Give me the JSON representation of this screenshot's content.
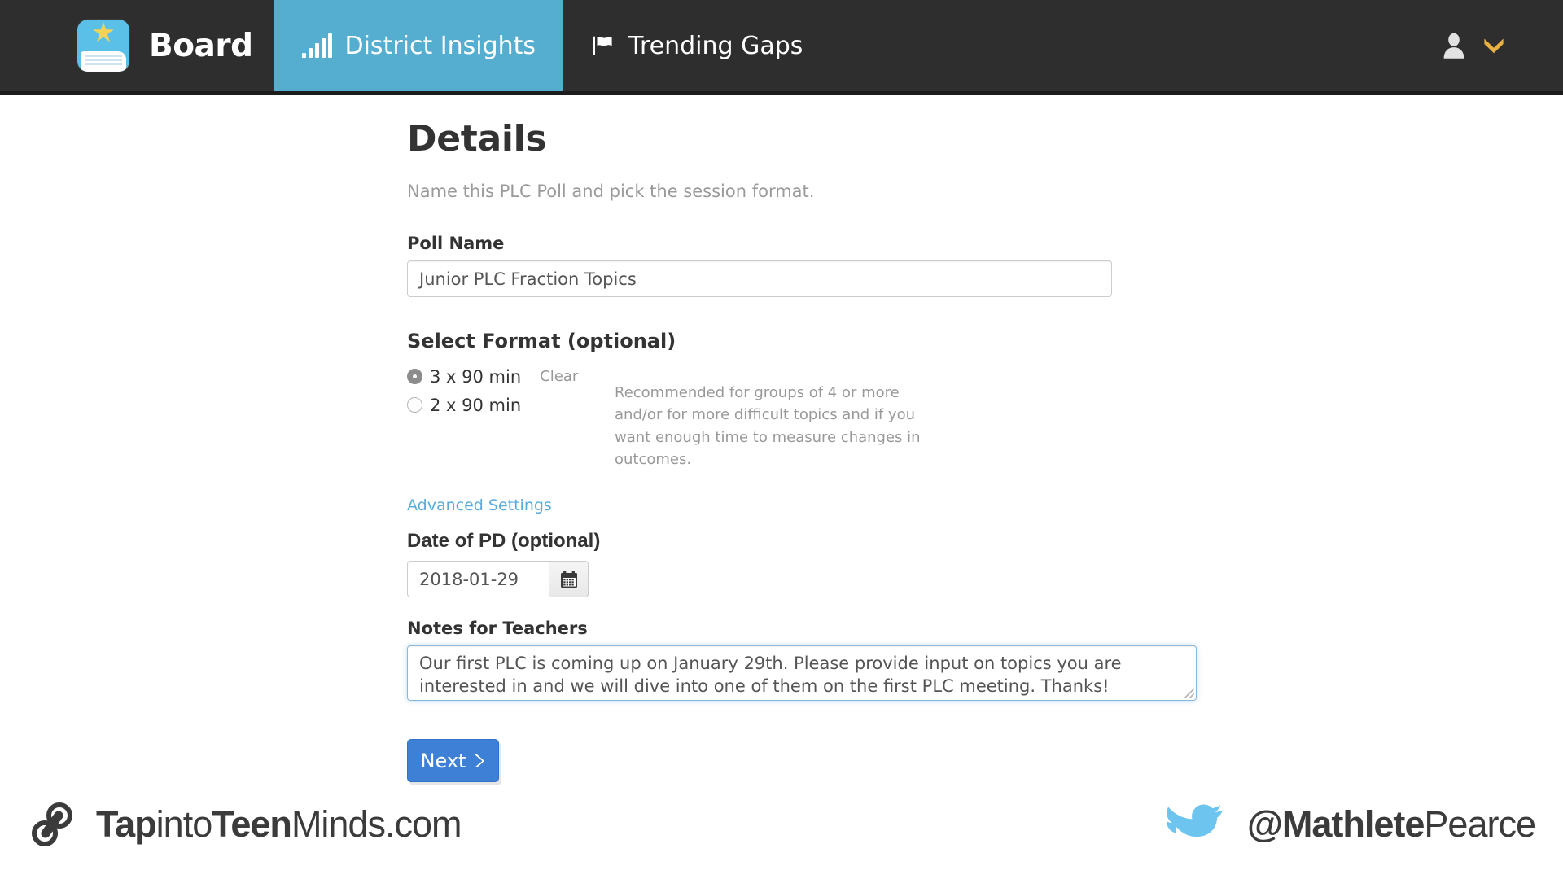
{
  "navbar": {
    "brand": {
      "label": "Board",
      "icon": "book-star-icon"
    },
    "tabs": [
      {
        "label": "District Insights",
        "icon": "bar-chart-icon",
        "active": true
      },
      {
        "label": "Trending Gaps",
        "icon": "flag-icon",
        "active": false
      }
    ],
    "account": {
      "user_icon": "user-icon",
      "caret_icon": "chevron-down-icon"
    },
    "colors": {
      "bar": "#2e2e2e",
      "active_tab": "#55aed0",
      "caret": "#e8b142"
    }
  },
  "page": {
    "title": "Details",
    "subtitle": "Name this PLC Poll and pick the session format."
  },
  "poll_name": {
    "label": "Poll Name",
    "value": "Junior PLC Fraction Topics",
    "placeholder": "Poll Name"
  },
  "format": {
    "heading": "Select Format (optional)",
    "options": [
      {
        "label": "3 x 90 min",
        "selected": true
      },
      {
        "label": "2 x 90 min",
        "selected": false
      }
    ],
    "clear_label": "Clear",
    "help_text": "Recommended for groups of 4 or more and/or for more difficult topics and if you want enough time to measure changes in outcomes."
  },
  "advanced_settings": {
    "label": "Advanced Settings",
    "color": "#5bacdc"
  },
  "date_of_pd": {
    "label": "Date of PD (optional)",
    "value": "2018-01-29",
    "placeholder": "YYYY-MM-DD",
    "button_icon": "calendar-icon"
  },
  "notes": {
    "label": "Notes for Teachers",
    "value": "Our first PLC is coming up on January 29th. Please provide input on topics you are interested in and we will dive into one of them on the first PLC meeting. Thanks!",
    "placeholder": "Notes for Teachers",
    "focus_color": "#66afe9"
  },
  "next_button": {
    "label": "Next",
    "icon": "chevron-right-icon",
    "color": "#3e80d6"
  },
  "footer": {
    "left": {
      "icon": "chain-link-icon",
      "wordmark_bold_1": "Tap",
      "wordmark_light_1": "into",
      "wordmark_bold_2": "Teen",
      "wordmark_light_2": "Minds.com"
    },
    "right": {
      "icon": "twitter-bird-icon",
      "handle_bold": "@Mathlete",
      "handle_light": "Pearce"
    }
  }
}
